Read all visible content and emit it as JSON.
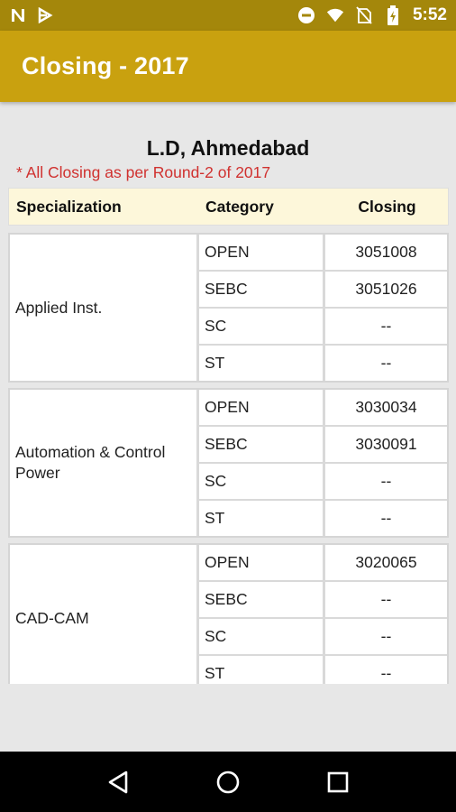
{
  "status_bar": {
    "time": "5:52",
    "bg_color": "#a4870b",
    "left_icons": [
      "n-notification-icon",
      "download-notification-icon"
    ],
    "right_icons": [
      "do-not-disturb-icon",
      "wifi-icon",
      "no-sim-icon",
      "battery-charging-icon"
    ]
  },
  "app_bar": {
    "title": "Closing - 2017",
    "bg_color": "#c9a10f"
  },
  "college": {
    "name": "L.D, Ahmedabad",
    "note": "* All Closing as per Round-2 of 2017"
  },
  "table": {
    "headers": {
      "specialization": "Specialization",
      "category": "Category",
      "closing": "Closing"
    },
    "groups": [
      {
        "specialization": "Applied Inst.",
        "rows": [
          {
            "category": "OPEN",
            "closing": "3051008"
          },
          {
            "category": "SEBC",
            "closing": "3051026"
          },
          {
            "category": "SC",
            "closing": "--"
          },
          {
            "category": "ST",
            "closing": "--"
          }
        ]
      },
      {
        "specialization": "Automation & Control Power",
        "rows": [
          {
            "category": "OPEN",
            "closing": "3030034"
          },
          {
            "category": "SEBC",
            "closing": "3030091"
          },
          {
            "category": "SC",
            "closing": "--"
          },
          {
            "category": "ST",
            "closing": "--"
          }
        ]
      },
      {
        "specialization": "CAD-CAM",
        "rows": [
          {
            "category": "OPEN",
            "closing": "3020065"
          },
          {
            "category": "SEBC",
            "closing": "--"
          },
          {
            "category": "SC",
            "closing": "--"
          },
          {
            "category": "ST",
            "closing": "--"
          }
        ]
      }
    ]
  },
  "nav_bar": {
    "buttons": [
      "back-icon",
      "home-icon",
      "recents-icon"
    ]
  }
}
